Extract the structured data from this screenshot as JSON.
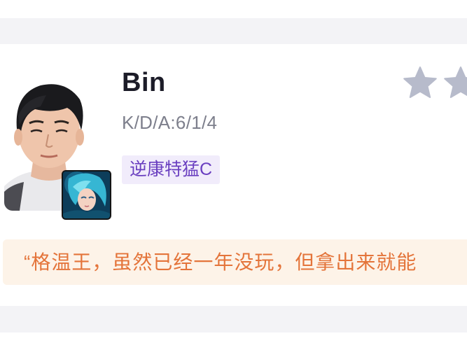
{
  "player": {
    "name": "Bin",
    "kda": "K/D/A:6/1/4",
    "tag": "逆康特猛C",
    "hero_icon": "hero-gwen-icon",
    "rating_icons": [
      "star-icon",
      "star-icon"
    ]
  },
  "quote": {
    "text": "“格温王，虽然已经一年没玩，但拿出来就能"
  },
  "colors": {
    "name": "#1c1c28",
    "kda": "#7d7f8c",
    "tag_bg": "#f1ecfb",
    "tag_text": "#6a3fc0",
    "star": "#b7bbcb",
    "quote_bg": "#fdf3e8",
    "quote_text": "#e4743a"
  }
}
